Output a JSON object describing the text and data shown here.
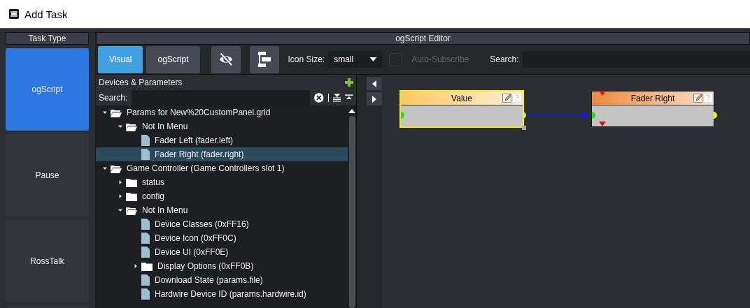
{
  "window": {
    "title": "Add Task"
  },
  "task_type": {
    "title": "Task Type",
    "items": [
      {
        "label": "ogScript",
        "selected": true
      },
      {
        "label": "Pause",
        "selected": false
      },
      {
        "label": "RossTalk",
        "selected": false
      }
    ]
  },
  "editor": {
    "title": "ogScript Editor",
    "mode_tabs": [
      {
        "label": "Visual",
        "selected": true
      },
      {
        "label": "ogScript",
        "selected": false
      }
    ],
    "icon_size": {
      "label": "Icon Size:",
      "value": "small"
    },
    "auto_subscribe": {
      "label": "Auto-Subscribe",
      "checked": false,
      "disabled": true
    },
    "search": {
      "label": "Search:"
    }
  },
  "devices": {
    "title": "Devices & Parameters",
    "search_label": "Search:",
    "tree": [
      {
        "label": "Params for New%20CustomPanel.grid",
        "kind": "folder",
        "expanded": true,
        "selected": false,
        "children": [
          {
            "label": "Not In Menu",
            "kind": "folder",
            "expanded": true,
            "selected": false,
            "children": [
              {
                "label": "Fader Left (fader.left)",
                "kind": "param",
                "selected": false
              },
              {
                "label": "Fader Right (fader.right)",
                "kind": "param",
                "selected": true
              }
            ]
          }
        ]
      },
      {
        "label": "Game Controller (Game Controllers slot 1)",
        "kind": "folder",
        "expanded": true,
        "selected": false,
        "children": [
          {
            "label": "status",
            "kind": "folder",
            "expanded": false,
            "selected": false
          },
          {
            "label": "config",
            "kind": "folder",
            "expanded": false,
            "selected": false
          },
          {
            "label": "Not In Menu",
            "kind": "folder",
            "expanded": true,
            "selected": false,
            "children": [
              {
                "label": "Device Classes (0xFF16)",
                "kind": "param",
                "selected": false
              },
              {
                "label": "Device Icon (0xFF0C)",
                "kind": "param",
                "selected": false
              },
              {
                "label": "Device UI (0xFF0E)",
                "kind": "param",
                "selected": false
              },
              {
                "label": "Display Options (0xFF0B)",
                "kind": "folder",
                "expanded": false,
                "selected": false
              },
              {
                "label": "Download State (params.file)",
                "kind": "param",
                "selected": false
              },
              {
                "label": "Hardwire Device ID (params.hardwire.id)",
                "kind": "param",
                "selected": false
              }
            ]
          }
        ]
      }
    ]
  },
  "canvas": {
    "nodes": [
      {
        "title": "Value",
        "selected": true,
        "kind": "value"
      },
      {
        "title": "Fader Right",
        "selected": false,
        "kind": "param"
      }
    ]
  }
}
